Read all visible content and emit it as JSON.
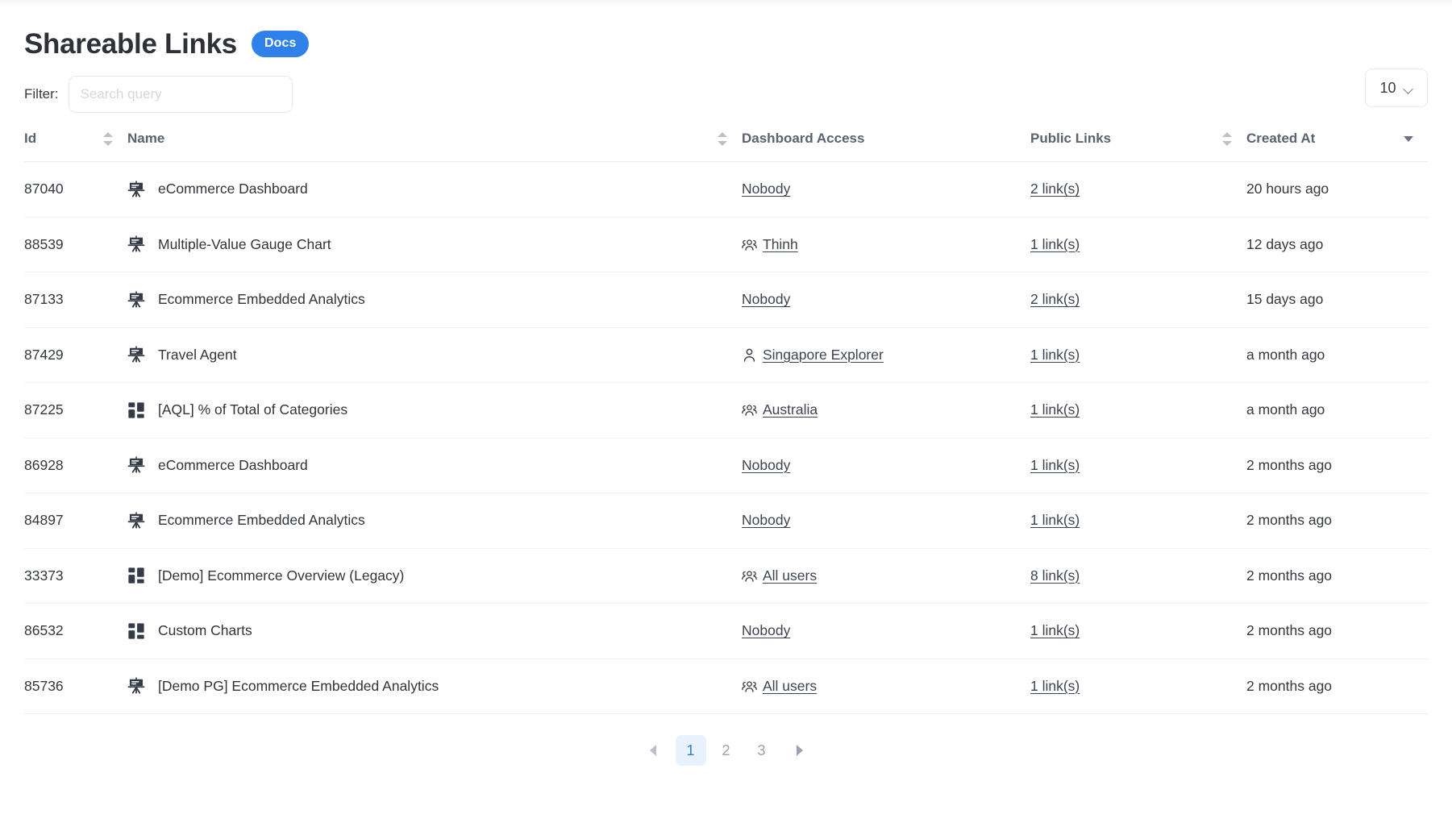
{
  "header": {
    "title": "Shareable Links",
    "badge": "Docs",
    "badge_color": "#2f80e8"
  },
  "toolbar": {
    "filter_label": "Filter:",
    "search_placeholder": "Search query",
    "search_value": "",
    "page_size": "10"
  },
  "table": {
    "columns": [
      {
        "label": "Id",
        "sort": "both"
      },
      {
        "label": "Name",
        "sort": "both"
      },
      {
        "label": "Dashboard Access",
        "sort": "none"
      },
      {
        "label": "Public Links",
        "sort": "both"
      },
      {
        "label": "Created At",
        "sort": "desc"
      }
    ],
    "rows": [
      {
        "id": "87040",
        "icon": "easel-icon",
        "name": "eCommerce Dashboard",
        "access": "Nobody",
        "access_icon": "none",
        "links": "2 link(s)",
        "created": "20 hours ago"
      },
      {
        "id": "88539",
        "icon": "easel-icon",
        "name": "Multiple-Value Gauge Chart",
        "access": "Thinh",
        "access_icon": "group",
        "links": "1 link(s)",
        "created": "12 days ago"
      },
      {
        "id": "87133",
        "icon": "easel-icon",
        "name": "Ecommerce Embedded Analytics",
        "access": "Nobody",
        "access_icon": "none",
        "links": "2 link(s)",
        "created": "15 days ago"
      },
      {
        "id": "87429",
        "icon": "easel-icon",
        "name": "Travel Agent",
        "access": "Singapore Explorer",
        "access_icon": "person",
        "links": "1 link(s)",
        "created": "a month ago"
      },
      {
        "id": "87225",
        "icon": "grid-icon",
        "name": "[AQL] % of Total of Categories",
        "access": "Australia",
        "access_icon": "group",
        "links": "1 link(s)",
        "created": "a month ago"
      },
      {
        "id": "86928",
        "icon": "easel-icon",
        "name": "eCommerce Dashboard",
        "access": "Nobody",
        "access_icon": "none",
        "links": "1 link(s)",
        "created": "2 months ago"
      },
      {
        "id": "84897",
        "icon": "easel-icon",
        "name": "Ecommerce Embedded Analytics",
        "access": "Nobody",
        "access_icon": "none",
        "links": "1 link(s)",
        "created": "2 months ago"
      },
      {
        "id": "33373",
        "icon": "grid-icon",
        "name": "[Demo] Ecommerce Overview (Legacy)",
        "access": "All users",
        "access_icon": "group",
        "links": "8 link(s)",
        "created": "2 months ago"
      },
      {
        "id": "86532",
        "icon": "grid-icon",
        "name": "Custom Charts",
        "access": "Nobody",
        "access_icon": "none",
        "links": "1 link(s)",
        "created": "2 months ago"
      },
      {
        "id": "85736",
        "icon": "easel-icon",
        "name": "[Demo PG] Ecommerce Embedded Analytics",
        "access": "All users",
        "access_icon": "group",
        "links": "1 link(s)",
        "created": "2 months ago"
      }
    ]
  },
  "pagination": {
    "prev_icon": "triangle-left-icon",
    "next_icon": "triangle-right-icon",
    "pages": [
      "1",
      "2",
      "3"
    ],
    "active_page": "1",
    "active_color": "#2e7fd4",
    "active_bg": "#e8f2fd"
  }
}
